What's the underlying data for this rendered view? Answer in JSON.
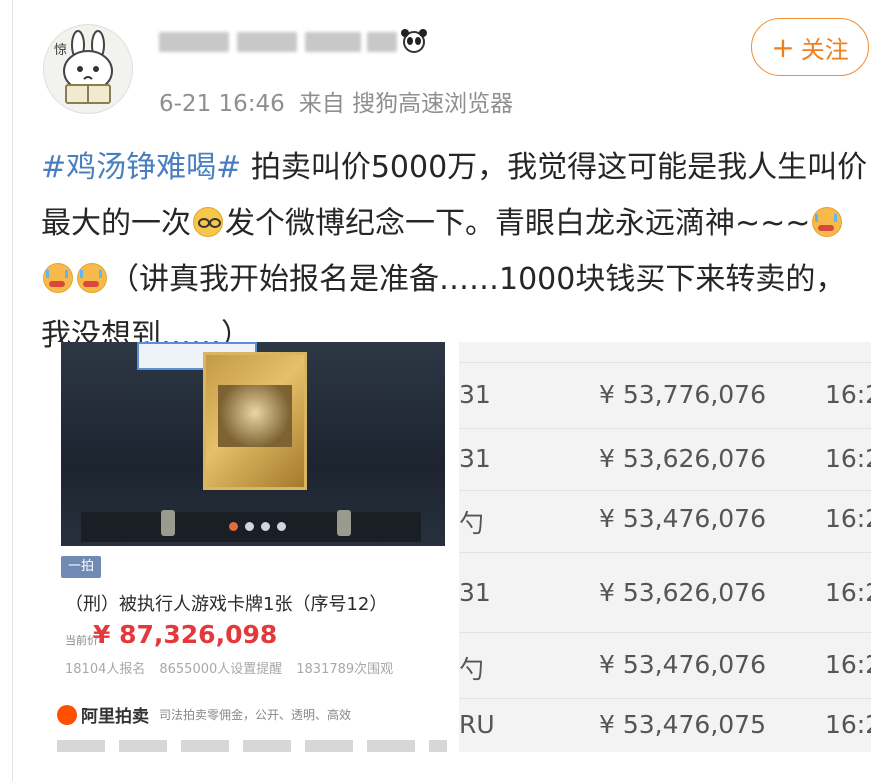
{
  "header": {
    "avatar_label": "惊",
    "timestamp": "6-21 16:46",
    "source": "来自 搜狗高速浏览器",
    "follow_plus": "+",
    "follow_label": "关注"
  },
  "post": {
    "hashtag": "#鸡汤铮难喝#",
    "text_part1": " 拍卖叫价5000万，我觉得这可能是我人生叫价最大的一次",
    "text_part2": "发个微博纪念一下。青眼白龙永远滴神~~~",
    "text_part3": "（讲真我开始报名是准备……1000块钱买下来转卖的，我没想到……）",
    "emojis": [
      "glasses-emoji",
      "crying-emoji",
      "crying-emoji",
      "crying-emoji"
    ]
  },
  "auction_card": {
    "tag": "一拍",
    "title": "（刑）被执行人游戏卡牌1张（序号12）",
    "price_label": "当前价",
    "price": "¥ 87,326,098",
    "stats": [
      "18104人报名",
      "8655000人设置提醒",
      "1831789次围观"
    ],
    "brand_name": "阿里拍卖",
    "brand_slogan": "司法拍卖零佣金，公开、透明、高效"
  },
  "bid_table": {
    "rows": [
      {
        "bidder": "31",
        "amount": "¥ 53,776,076",
        "time": "16:2"
      },
      {
        "bidder": "31",
        "amount": "¥ 53,626,076",
        "time": "16:2"
      },
      {
        "bidder": "勺",
        "amount": "¥ 53,476,076",
        "time": "16:2"
      },
      {
        "bidder": "31",
        "amount": "¥ 53,626,076",
        "time": "16:2"
      },
      {
        "bidder": "勺",
        "amount": "¥ 53,476,076",
        "time": "16:2"
      },
      {
        "bidder": "RU",
        "amount": "¥ 53,476,075",
        "time": "16:2"
      }
    ]
  },
  "colors": {
    "accent": "#ef7f1a",
    "hashtag": "#4a7fbf",
    "price": "#e4393c",
    "meta_text": "#8f8f8f"
  }
}
